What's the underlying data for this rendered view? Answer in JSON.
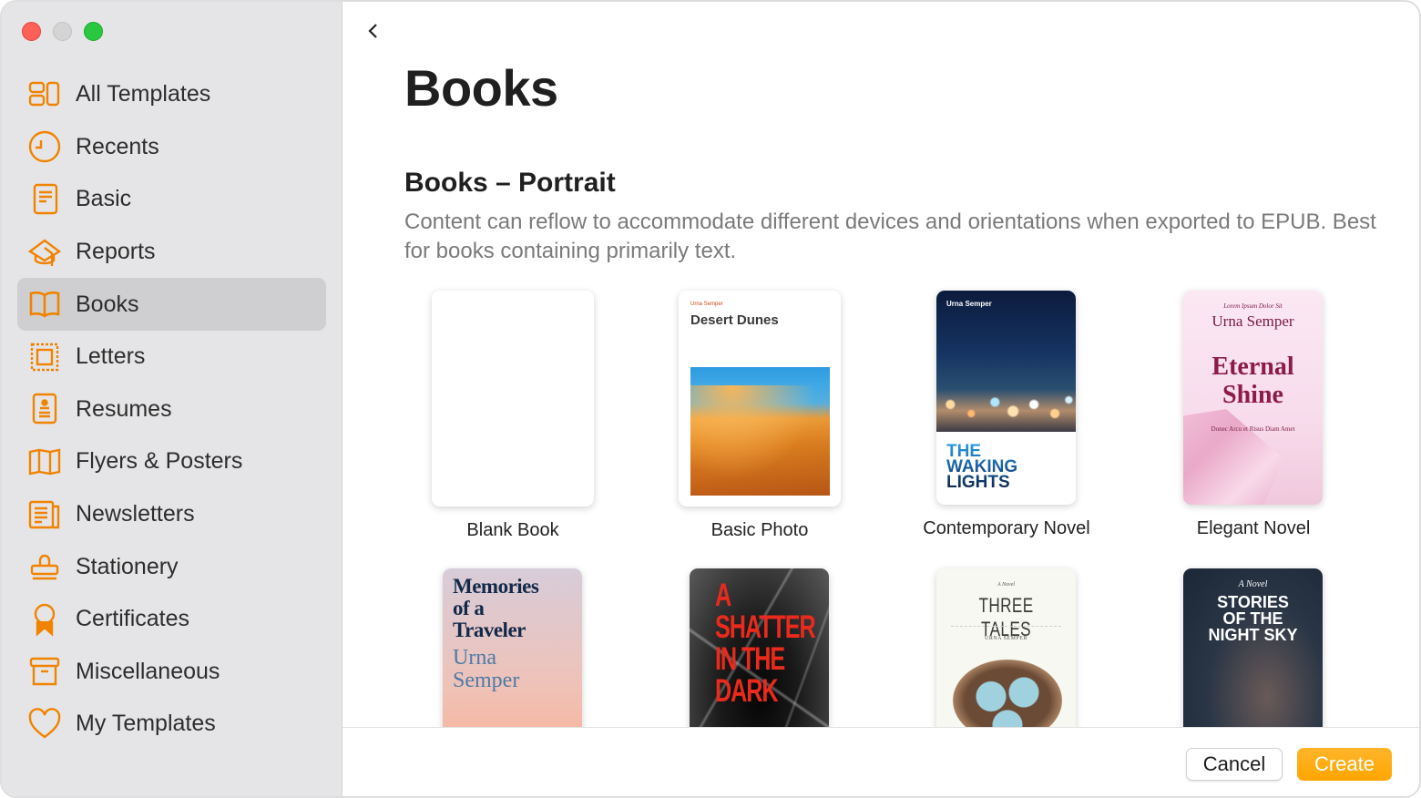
{
  "window": {
    "controls": [
      "close",
      "minimize",
      "maximize"
    ]
  },
  "sidebar": {
    "accent_color": "#f08300",
    "selected": "Books",
    "items": [
      {
        "label": "All Templates",
        "icon": "grid-icon"
      },
      {
        "label": "Recents",
        "icon": "clock-icon"
      },
      {
        "label": "Basic",
        "icon": "document-icon"
      },
      {
        "label": "Reports",
        "icon": "graduation-cap-icon"
      },
      {
        "label": "Books",
        "icon": "book-icon"
      },
      {
        "label": "Letters",
        "icon": "stamp-frame-icon"
      },
      {
        "label": "Resumes",
        "icon": "resume-icon"
      },
      {
        "label": "Flyers & Posters",
        "icon": "map-fold-icon"
      },
      {
        "label": "Newsletters",
        "icon": "newspaper-icon"
      },
      {
        "label": "Stationery",
        "icon": "rubber-stamp-icon"
      },
      {
        "label": "Certificates",
        "icon": "ribbon-award-icon"
      },
      {
        "label": "Miscellaneous",
        "icon": "archive-box-icon"
      },
      {
        "label": "My Templates",
        "icon": "heart-icon"
      }
    ]
  },
  "main": {
    "back_icon": "chevron-left-icon",
    "title": "Books",
    "section": {
      "title": "Books – Portrait",
      "description": "Content can reflow to accommodate different devices and orientations when exported to EPUB. Best for books containing primarily text."
    },
    "templates": [
      {
        "name": "Blank Book"
      },
      {
        "name": "Basic Photo",
        "cover": {
          "author": "Urna Semper",
          "title": "Desert Dunes"
        }
      },
      {
        "name": "Contemporary Novel",
        "cover": {
          "author": "Urna Semper",
          "title_lines": [
            "THE",
            "WAKING",
            "LIGHTS"
          ]
        }
      },
      {
        "name": "Elegant Novel",
        "cover": {
          "subtitle": "Lorem Ipsum Dolor Sit",
          "author": "Urna Semper",
          "title_lines": [
            "Eternal",
            "Shine"
          ],
          "tagline": "Donec Arcu et Risus Diam Amet"
        }
      },
      {
        "name": "",
        "cover": {
          "title_lines": [
            "Memories",
            "of a",
            "Traveler"
          ],
          "author_lines": [
            "Urna",
            "Semper"
          ]
        }
      },
      {
        "name": "",
        "cover": {
          "title_lines": [
            "A",
            "SHATTER",
            "IN THE",
            "DARK"
          ]
        }
      },
      {
        "name": "",
        "cover": {
          "subtitle": "A Novel",
          "title": "THREE TALES",
          "author": "URNA SEMPER"
        }
      },
      {
        "name": "",
        "cover": {
          "subtitle": "A Novel",
          "title_lines": [
            "STORIES",
            "OF THE",
            "NIGHT SKY"
          ]
        }
      }
    ]
  },
  "footer": {
    "cancel_label": "Cancel",
    "create_label": "Create",
    "create_color": "#ffa600"
  }
}
